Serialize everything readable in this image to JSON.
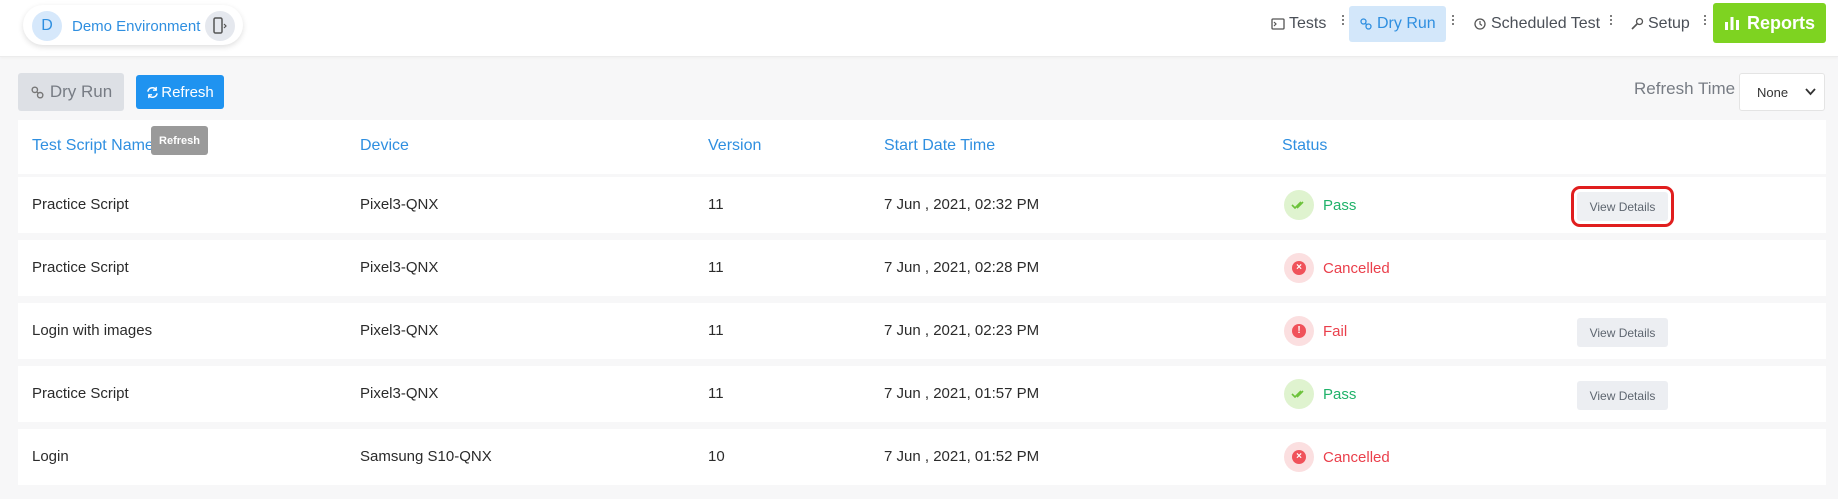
{
  "environment": {
    "avatar_letter": "D",
    "name": "Demo Environment"
  },
  "nav": {
    "tests": "Tests",
    "dry_run": "Dry Run",
    "scheduled_test": "Scheduled Test",
    "setup": "Setup",
    "reports": "Reports"
  },
  "toolbar": {
    "dry_run_label": "Dry Run",
    "refresh_label": "Refresh",
    "refresh_time_label": "Refresh Time",
    "refresh_time_value": "None"
  },
  "tooltip": "Refresh",
  "table": {
    "columns": [
      "Test Script Name",
      "Device",
      "Version",
      "Start Date Time",
      "Status"
    ],
    "rows": [
      {
        "script": "Practice Script",
        "device": "Pixel3-QNX",
        "version": "11",
        "start": "7 Jun , 2021, 02:32 PM",
        "status": "Pass",
        "action": "View Details"
      },
      {
        "script": "Practice Script",
        "device": "Pixel3-QNX",
        "version": "11",
        "start": "7 Jun , 2021, 02:28 PM",
        "status": "Cancelled",
        "action": ""
      },
      {
        "script": "Login with images",
        "device": "Pixel3-QNX",
        "version": "11",
        "start": "7 Jun , 2021, 02:23 PM",
        "status": "Fail",
        "action": "View Details"
      },
      {
        "script": "Practice Script",
        "device": "Pixel3-QNX",
        "version": "11",
        "start": "7 Jun , 2021, 01:57 PM",
        "status": "Pass",
        "action": "View Details"
      },
      {
        "script": "Login",
        "device": "Samsung S10-QNX",
        "version": "10",
        "start": "7 Jun , 2021, 01:52 PM",
        "status": "Cancelled",
        "action": ""
      }
    ]
  },
  "colors": {
    "accent": "#2f8fe0",
    "reports": "#7ed321",
    "refresh": "#1f93f0",
    "pass": "#20b26a",
    "fail": "#ea3f4b",
    "highlight": "#e01e1e"
  }
}
